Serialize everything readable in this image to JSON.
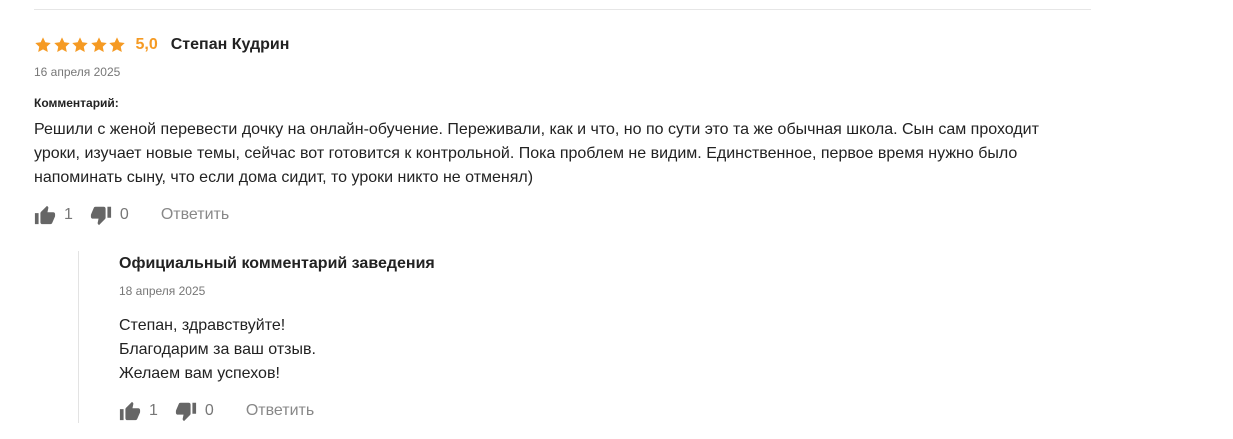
{
  "review": {
    "stars_filled": 5,
    "stars_total": 5,
    "rating": "5,0",
    "author": "Степан Кудрин",
    "date": "16 апреля 2025",
    "comment_label": "Комментарий:",
    "comment_text": "Решили с женой перевести дочку на онлайн-обучение. Переживали, как и что, но по сути это та же обычная школа. Сын сам проходит уроки, изучает новые темы, сейчас вот готовится к контрольной. Пока проблем не видим. Единственное, первое время нужно было напоминать сыну, что если дома сидит, то уроки никто не отменял)",
    "likes": "1",
    "dislikes": "0",
    "reply_label": "Ответить"
  },
  "official_reply": {
    "title": "Официальный комментарий заведения",
    "date": "18 апреля 2025",
    "lines": [
      "Степан, здравствуйте!",
      "Благодарим за ваш отзыв.",
      "Желаем вам успехов!"
    ],
    "likes": "1",
    "dislikes": "0",
    "reply_label": "Ответить"
  },
  "colors": {
    "star": "#f59a23",
    "text": "#222222",
    "muted": "#777777",
    "vote_icon": "#666666"
  },
  "icons": {
    "star": "star-icon",
    "like": "thumbs-up-icon",
    "dislike": "thumbs-down-icon"
  }
}
